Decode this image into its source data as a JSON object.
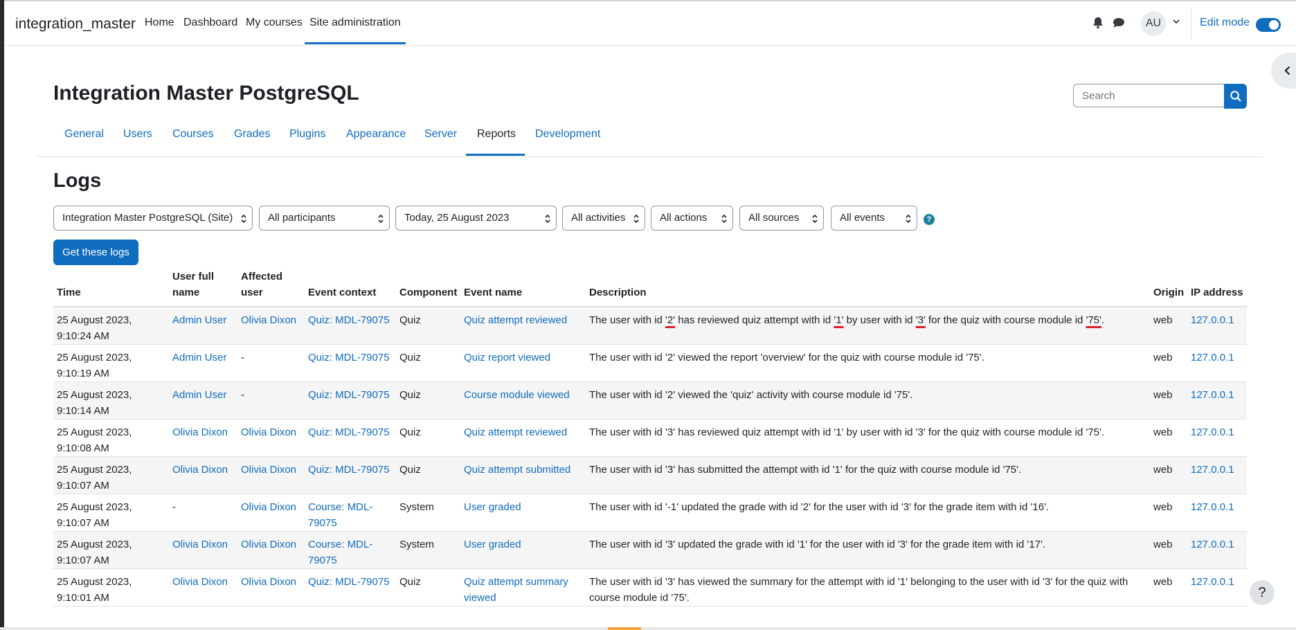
{
  "navbar": {
    "brand": "integration_master",
    "items": [
      "Home",
      "Dashboard",
      "My courses",
      "Site administration"
    ],
    "avatar_initials": "AU",
    "edit_mode_label": "Edit mode"
  },
  "page": {
    "title": "Integration Master PostgreSQL",
    "search_placeholder": "Search",
    "tabs": [
      "General",
      "Users",
      "Courses",
      "Grades",
      "Plugins",
      "Appearance",
      "Server",
      "Reports",
      "Development"
    ],
    "active_tab": "Reports",
    "section_title": "Logs"
  },
  "filters": {
    "course": "Integration Master PostgreSQL (Site)",
    "participants": "All participants",
    "date": "Today, 25 August 2023",
    "activities": "All activities",
    "actions": "All actions",
    "sources": "All sources",
    "events": "All events",
    "help": "?",
    "submit": "Get these logs"
  },
  "table": {
    "headers": [
      "Time",
      "User full name",
      "Affected user",
      "Event context",
      "Component",
      "Event name",
      "Description",
      "Origin",
      "IP address"
    ],
    "rows": [
      {
        "time": "25 August 2023, 9:10:24 AM",
        "user": "Admin User",
        "affected": "Olivia Dixon",
        "context": "Quiz: MDL-79075",
        "component": "Quiz",
        "event": "Quiz attempt reviewed",
        "description": "The user with id '2' has reviewed quiz attempt with id '1' by user with id '3' for the quiz with course module id '75'.",
        "origin": "web",
        "ip": "127.0.0.1"
      },
      {
        "time": "25 August 2023, 9:10:19 AM",
        "user": "Admin User",
        "affected": "-",
        "context": "Quiz: MDL-79075",
        "component": "Quiz",
        "event": "Quiz report viewed",
        "description": "The user with id '2' viewed the report 'overview' for the quiz with course module id '75'.",
        "origin": "web",
        "ip": "127.0.0.1"
      },
      {
        "time": "25 August 2023, 9:10:14 AM",
        "user": "Admin User",
        "affected": "-",
        "context": "Quiz: MDL-79075",
        "component": "Quiz",
        "event": "Course module viewed",
        "description": "The user with id '2' viewed the 'quiz' activity with course module id '75'.",
        "origin": "web",
        "ip": "127.0.0.1"
      },
      {
        "time": "25 August 2023, 9:10:08 AM",
        "user": "Olivia Dixon",
        "affected": "Olivia Dixon",
        "context": "Quiz: MDL-79075",
        "component": "Quiz",
        "event": "Quiz attempt reviewed",
        "description": "The user with id '3' has reviewed quiz attempt with id '1' by user with id '3' for the quiz with course module id '75'.",
        "origin": "web",
        "ip": "127.0.0.1"
      },
      {
        "time": "25 August 2023, 9:10:07 AM",
        "user": "Olivia Dixon",
        "affected": "Olivia Dixon",
        "context": "Quiz: MDL-79075",
        "component": "Quiz",
        "event": "Quiz attempt submitted",
        "description": "The user with id '3' has submitted the attempt with id '1' for the quiz with course module id '75'.",
        "origin": "web",
        "ip": "127.0.0.1"
      },
      {
        "time": "25 August 2023, 9:10:07 AM",
        "user": "-",
        "affected": "Olivia Dixon",
        "context": "Course: MDL-79075",
        "component": "System",
        "event": "User graded",
        "description": "The user with id '-1' updated the grade with id '2' for the user with id '3' for the grade item with id '16'.",
        "origin": "web",
        "ip": "127.0.0.1"
      },
      {
        "time": "25 August 2023, 9:10:07 AM",
        "user": "Olivia Dixon",
        "affected": "Olivia Dixon",
        "context": "Course: MDL-79075",
        "component": "System",
        "event": "User graded",
        "description": "The user with id '3' updated the grade with id '1' for the user with id '3' for the grade item with id '17'.",
        "origin": "web",
        "ip": "127.0.0.1"
      },
      {
        "time": "25 August 2023, 9:10:01 AM",
        "user": "Olivia Dixon",
        "affected": "Olivia Dixon",
        "context": "Quiz: MDL-79075",
        "component": "Quiz",
        "event": "Quiz attempt summary viewed",
        "description": "The user with id '3' has viewed the summary for the attempt with id '1' belonging to the user with id '3' for the quiz with course module id '75'.",
        "origin": "web",
        "ip": "127.0.0.1"
      }
    ]
  },
  "help_button": "?"
}
